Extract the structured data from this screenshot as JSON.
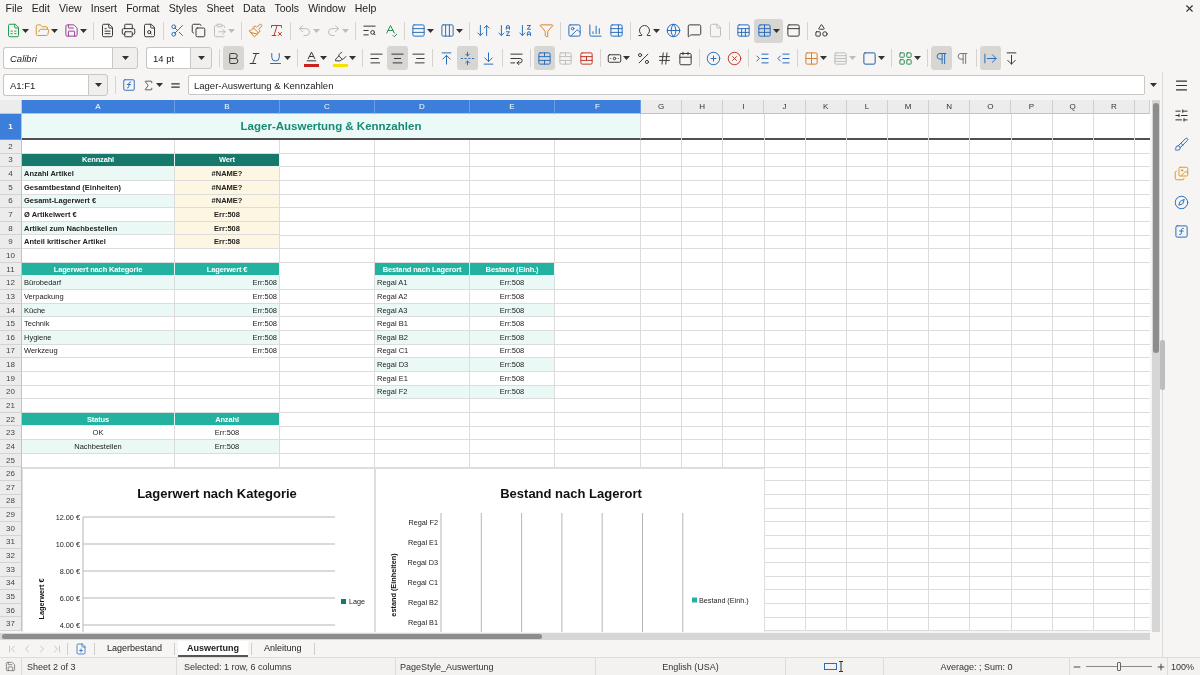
{
  "menu_bar": [
    "File",
    "Edit",
    "View",
    "Insert",
    "Format",
    "Styles",
    "Sheet",
    "Data",
    "Tools",
    "Window",
    "Help"
  ],
  "standard_toolbar": [
    [
      {
        "kind": "new",
        "dropdown": true,
        "disabled": false,
        "pressed": false
      },
      {
        "kind": "open",
        "dropdown": true,
        "disabled": false,
        "pressed": false
      },
      {
        "kind": "save",
        "dropdown": true,
        "disabled": false,
        "pressed": false
      }
    ],
    [
      {
        "kind": "pdf",
        "dropdown": false,
        "disabled": false,
        "pressed": false
      },
      {
        "kind": "print",
        "dropdown": false,
        "disabled": false,
        "pressed": false
      },
      {
        "kind": "preview",
        "dropdown": false,
        "disabled": false,
        "pressed": false
      }
    ],
    [
      {
        "kind": "cut",
        "dropdown": false,
        "disabled": false,
        "pressed": false
      },
      {
        "kind": "copy",
        "dropdown": false,
        "disabled": false,
        "pressed": false
      },
      {
        "kind": "paste",
        "dropdown": true,
        "disabled": true,
        "pressed": false
      }
    ],
    [
      {
        "kind": "clone",
        "dropdown": false,
        "disabled": false,
        "pressed": false
      },
      {
        "kind": "clear",
        "dropdown": false,
        "disabled": false,
        "pressed": false
      }
    ],
    [
      {
        "kind": "undo",
        "dropdown": true,
        "disabled": true,
        "pressed": false
      },
      {
        "kind": "redo",
        "dropdown": true,
        "disabled": true,
        "pressed": false
      }
    ],
    [
      {
        "kind": "find",
        "dropdown": false,
        "disabled": false,
        "pressed": false
      },
      {
        "kind": "spelling",
        "dropdown": false,
        "disabled": false,
        "pressed": false
      }
    ],
    [
      {
        "kind": "rows",
        "dropdown": true,
        "disabled": false,
        "pressed": false
      },
      {
        "kind": "columns",
        "dropdown": true,
        "disabled": false,
        "pressed": false
      }
    ],
    [
      {
        "kind": "sort",
        "dropdown": false,
        "disabled": false,
        "pressed": false
      },
      {
        "kind": "ascending",
        "dropdown": false,
        "disabled": false,
        "pressed": false
      },
      {
        "kind": "descending",
        "dropdown": false,
        "disabled": false,
        "pressed": false
      },
      {
        "kind": "autofilter",
        "dropdown": false,
        "disabled": false,
        "pressed": false
      }
    ],
    [
      {
        "kind": "image",
        "dropdown": false,
        "disabled": false,
        "pressed": false
      },
      {
        "kind": "chart",
        "dropdown": false,
        "disabled": false,
        "pressed": false
      },
      {
        "kind": "pivot",
        "dropdown": false,
        "disabled": false,
        "pressed": false
      }
    ],
    [
      {
        "kind": "special",
        "dropdown": true,
        "disabled": false,
        "pressed": false
      },
      {
        "kind": "hyperlink",
        "dropdown": false,
        "disabled": false,
        "pressed": false
      },
      {
        "kind": "comment",
        "dropdown": false,
        "disabled": false,
        "pressed": false
      },
      {
        "kind": "headers",
        "dropdown": false,
        "disabled": true,
        "pressed": false
      }
    ],
    [
      {
        "kind": "printarea",
        "dropdown": false,
        "disabled": false,
        "pressed": false
      },
      {
        "kind": "freeze",
        "dropdown": true,
        "disabled": false,
        "pressed": true
      },
      {
        "kind": "split",
        "dropdown": false,
        "disabled": false,
        "pressed": false
      }
    ],
    [
      {
        "kind": "shapes",
        "dropdown": false,
        "disabled": false,
        "pressed": false
      }
    ]
  ],
  "formatting_toolbar": {
    "font_name": "Calibri",
    "font_size": "14 pt",
    "groups": [
      [
        {
          "kind": "bold",
          "dropdown": false,
          "disabled": false,
          "pressed": true
        },
        {
          "kind": "italic",
          "dropdown": false,
          "disabled": false,
          "pressed": false
        },
        {
          "kind": "underline",
          "dropdown": true,
          "disabled": false,
          "pressed": false
        }
      ],
      [
        {
          "kind": "fontcolor",
          "dropdown": true,
          "disabled": false,
          "pressed": false
        },
        {
          "kind": "highlight",
          "dropdown": true,
          "disabled": false,
          "pressed": false
        }
      ],
      [
        {
          "kind": "alignleft",
          "dropdown": false,
          "disabled": false,
          "pressed": false
        },
        {
          "kind": "aligncenter",
          "dropdown": false,
          "disabled": false,
          "pressed": true
        },
        {
          "kind": "alignright",
          "dropdown": false,
          "disabled": false,
          "pressed": false
        }
      ],
      [
        {
          "kind": "aligntop",
          "dropdown": false,
          "disabled": false,
          "pressed": false
        },
        {
          "kind": "alignmiddle",
          "dropdown": false,
          "disabled": false,
          "pressed": true
        },
        {
          "kind": "alignbottom",
          "dropdown": false,
          "disabled": false,
          "pressed": false
        }
      ],
      [
        {
          "kind": "wrap",
          "dropdown": false,
          "disabled": false,
          "pressed": false
        }
      ],
      [
        {
          "kind": "mergecenter",
          "dropdown": false,
          "disabled": false,
          "pressed": true
        },
        {
          "kind": "merge",
          "dropdown": false,
          "disabled": true,
          "pressed": false
        },
        {
          "kind": "unmerge",
          "dropdown": false,
          "disabled": false,
          "pressed": false
        }
      ],
      [
        {
          "kind": "currency",
          "dropdown": true,
          "disabled": false,
          "pressed": false
        },
        {
          "kind": "percent",
          "dropdown": false,
          "disabled": false,
          "pressed": false
        },
        {
          "kind": "standard",
          "dropdown": false,
          "disabled": false,
          "pressed": false
        },
        {
          "kind": "date",
          "dropdown": false,
          "disabled": false,
          "pressed": false
        }
      ],
      [
        {
          "kind": "adddecimal",
          "dropdown": false,
          "disabled": false,
          "pressed": false
        },
        {
          "kind": "deletedecimal",
          "dropdown": false,
          "disabled": false,
          "pressed": false
        }
      ],
      [
        {
          "kind": "indent",
          "dropdown": false,
          "disabled": false,
          "pressed": false
        },
        {
          "kind": "outdent",
          "dropdown": false,
          "disabled": false,
          "pressed": false
        }
      ],
      [
        {
          "kind": "borders",
          "dropdown": true,
          "disabled": false,
          "pressed": false
        },
        {
          "kind": "borderstyle",
          "dropdown": true,
          "disabled": true,
          "pressed": false
        },
        {
          "kind": "bordercolor",
          "dropdown": true,
          "disabled": false,
          "pressed": false
        }
      ],
      [
        {
          "kind": "conditional",
          "dropdown": true,
          "disabled": false,
          "pressed": false
        }
      ],
      [
        {
          "kind": "ltr",
          "dropdown": false,
          "disabled": false,
          "pressed": true
        },
        {
          "kind": "rtl",
          "dropdown": false,
          "disabled": false,
          "pressed": false
        }
      ],
      [
        {
          "kind": "horizontal",
          "dropdown": false,
          "disabled": false,
          "pressed": true
        },
        {
          "kind": "vertical",
          "dropdown": false,
          "disabled": false,
          "pressed": false
        }
      ]
    ]
  },
  "formula_bar": {
    "name_box": "A1:F1",
    "content": "Lager-Auswertung & Kennzahlen"
  },
  "sheet": {
    "column_headers": [
      {
        "label": "A",
        "selected": true
      },
      {
        "label": "B",
        "selected": true
      },
      {
        "label": "C",
        "selected": true
      },
      {
        "label": "D",
        "selected": true
      },
      {
        "label": "E",
        "selected": true
      },
      {
        "label": "F",
        "selected": true
      },
      {
        "label": "G",
        "selected": false
      },
      {
        "label": "H",
        "selected": false
      },
      {
        "label": "I",
        "selected": false
      },
      {
        "label": "J",
        "selected": false
      },
      {
        "label": "K",
        "selected": false
      },
      {
        "label": "L",
        "selected": false
      },
      {
        "label": "M",
        "selected": false
      },
      {
        "label": "N",
        "selected": false
      },
      {
        "label": "O",
        "selected": false
      },
      {
        "label": "P",
        "selected": false
      },
      {
        "label": "Q",
        "selected": false
      },
      {
        "label": "R",
        "selected": false
      }
    ],
    "row_headers": [
      {
        "label": "1",
        "selected": true
      },
      {
        "label": "2",
        "selected": false
      },
      {
        "label": "3",
        "selected": false
      },
      {
        "label": "4",
        "selected": false
      },
      {
        "label": "5",
        "selected": false
      },
      {
        "label": "6",
        "selected": false
      },
      {
        "label": "7",
        "selected": false
      },
      {
        "label": "8",
        "selected": false
      },
      {
        "label": "9",
        "selected": false
      },
      {
        "label": "10",
        "selected": false
      },
      {
        "label": "11",
        "selected": false
      },
      {
        "label": "12",
        "selected": false
      },
      {
        "label": "13",
        "selected": false
      },
      {
        "label": "14",
        "selected": false
      },
      {
        "label": "15",
        "selected": false
      },
      {
        "label": "16",
        "selected": false
      },
      {
        "label": "17",
        "selected": false
      },
      {
        "label": "18",
        "selected": false
      },
      {
        "label": "19",
        "selected": false
      },
      {
        "label": "20",
        "selected": false
      },
      {
        "label": "21",
        "selected": false
      },
      {
        "label": "22",
        "selected": false
      },
      {
        "label": "23",
        "selected": false
      },
      {
        "label": "24",
        "selected": false
      },
      {
        "label": "25",
        "selected": false
      },
      {
        "label": "26",
        "selected": false
      },
      {
        "label": "27",
        "selected": false
      },
      {
        "label": "28",
        "selected": false
      },
      {
        "label": "29",
        "selected": false
      },
      {
        "label": "30",
        "selected": false
      },
      {
        "label": "31",
        "selected": false
      },
      {
        "label": "32",
        "selected": false
      },
      {
        "label": "33",
        "selected": false
      },
      {
        "label": "34",
        "selected": false
      },
      {
        "label": "35",
        "selected": false
      },
      {
        "label": "36",
        "selected": false
      },
      {
        "label": "37",
        "selected": false
      }
    ],
    "title": "Lager-Auswertung & Kennzahlen",
    "kpi_table": {
      "header": [
        "Kennzahl",
        "Wert"
      ],
      "rows": [
        {
          "label": "Anzahl Artikel",
          "value": "#NAME?"
        },
        {
          "label": "Gesamtbestand (Einheiten)",
          "value": "#NAME?"
        },
        {
          "label": "Gesamt-Lagerwert €",
          "value": "#NAME?"
        },
        {
          "label": "Ø Artikelwert €",
          "value": "Err:508"
        },
        {
          "label": "Artikel zum Nachbestellen",
          "value": "Err:508"
        },
        {
          "label": "Anteil kritischer Artikel",
          "value": "Err:508"
        }
      ]
    },
    "category_table": {
      "header": [
        "Lagerwert nach Kategorie",
        "Lagerwert €"
      ],
      "rows": [
        {
          "label": "Bürobedarf",
          "value": "Err:508"
        },
        {
          "label": "Verpackung",
          "value": "Err:508"
        },
        {
          "label": "Küche",
          "value": "Err:508"
        },
        {
          "label": "Technik",
          "value": "Err:508"
        },
        {
          "label": "Hygiene",
          "value": "Err:508"
        },
        {
          "label": "Werkzeug",
          "value": "Err:508"
        }
      ]
    },
    "location_table": {
      "header": [
        "Bestand nach Lagerort",
        "Bestand (Einh.)"
      ],
      "rows": [
        {
          "label": "Regal A1",
          "value": "Err:508"
        },
        {
          "label": "Regal A2",
          "value": "Err:508"
        },
        {
          "label": "Regal A3",
          "value": "Err:508"
        },
        {
          "label": "Regal B1",
          "value": "Err:508"
        },
        {
          "label": "Regal B2",
          "value": "Err:508"
        },
        {
          "label": "Regal C1",
          "value": "Err:508"
        },
        {
          "label": "Regal D3",
          "value": "Err:508"
        },
        {
          "label": "Regal E1",
          "value": "Err:508"
        },
        {
          "label": "Regal F2",
          "value": "Err:508"
        }
      ]
    },
    "status_table": {
      "header": [
        "Status",
        "Anzahl"
      ],
      "rows": [
        {
          "label": "OK",
          "value": "Err:508"
        },
        {
          "label": "Nachbestellen",
          "value": "Err:508"
        }
      ]
    },
    "value_chart": {
      "chart_data": {
        "type": "bar",
        "title": "Lagerwert nach Kategorie",
        "ylabel": "Lagerwert €",
        "ylim": [
          4,
          12
        ],
        "yticks": [
          {
            "value": 12,
            "label": "12.00 €"
          },
          {
            "value": 10,
            "label": "10.00 €"
          },
          {
            "value": 8,
            "label": "8.00 €"
          },
          {
            "value": 6,
            "label": "6.00 €"
          },
          {
            "value": 4,
            "label": "4.00 €"
          }
        ],
        "grid": true,
        "series": [
          {
            "name": "Lage",
            "color": "#17796c"
          }
        ]
      }
    },
    "location_chart": {
      "horizontal": true,
      "title": "Bestand nach Lagerort",
      "axis_title": "estand (Einheiten)",
      "categories": [
        "Regal F2",
        "Regal E1",
        "Regal D3",
        "Regal C1",
        "Regal B2",
        "Regal B1"
      ],
      "legend": [
        {
          "name": "Bestand (Einh.)",
          "color": "#23b5a2"
        }
      ]
    }
  },
  "tab_navigation": [
    {
      "kind": "first",
      "disabled": true
    },
    {
      "kind": "previous",
      "disabled": true
    },
    {
      "kind": "next",
      "disabled": true
    },
    {
      "kind": "last",
      "disabled": true
    }
  ],
  "sheet_tabs": [
    {
      "label": "Lagerbestand",
      "selected": false
    },
    {
      "label": "Auswertung",
      "selected": true
    },
    {
      "label": "Anleitung",
      "selected": false
    }
  ],
  "status_bar": {
    "sheet": "Sheet 2 of 3",
    "selection": "Selected: 1 row, 6 columns",
    "page_style": "PageStyle_Auswertung",
    "language": "English (USA)",
    "summary": "Average: ; Sum: 0",
    "zoom": {
      "level": 0.5,
      "reading": "100%"
    }
  }
}
